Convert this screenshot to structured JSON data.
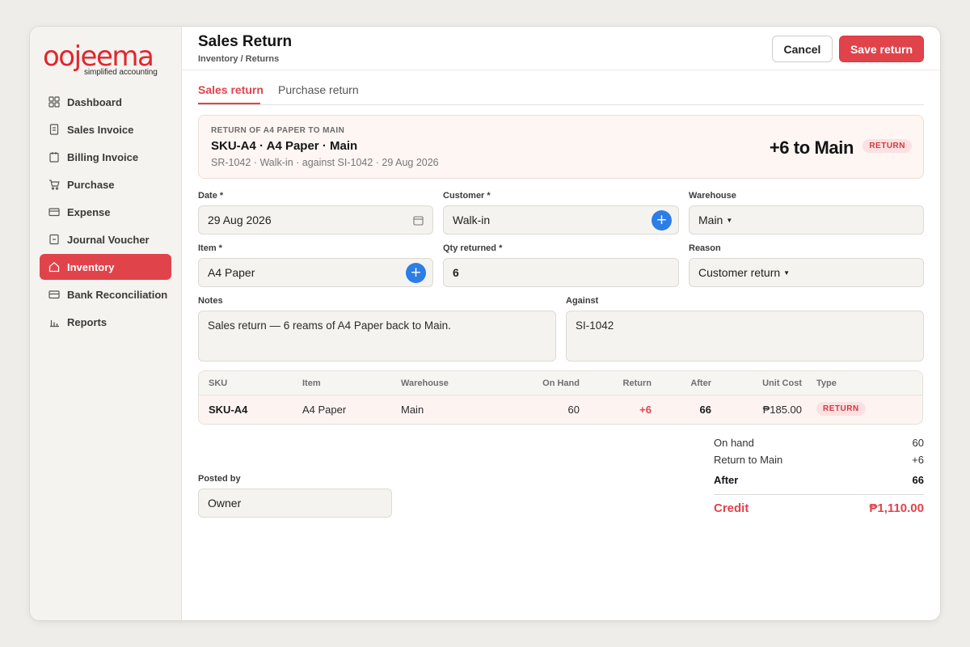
{
  "brand": {
    "name": "oojeema",
    "tagline": "simplified accounting",
    "color": "#e1262d"
  },
  "sidebar": {
    "items": [
      {
        "label": "Dashboard",
        "icon": "grid-icon",
        "active": false
      },
      {
        "label": "Sales Invoice",
        "icon": "document-icon",
        "active": false
      },
      {
        "label": "Billing Invoice",
        "icon": "clipboard-icon",
        "active": false
      },
      {
        "label": "Purchase",
        "icon": "cart-icon",
        "active": false
      },
      {
        "label": "Expense",
        "icon": "card-icon",
        "active": false
      },
      {
        "label": "Journal Voucher",
        "icon": "journal-icon",
        "active": false
      },
      {
        "label": "Inventory",
        "icon": "home-icon",
        "active": true
      },
      {
        "label": "Bank Reconciliation",
        "icon": "bank-card-icon",
        "active": false
      },
      {
        "label": "Reports",
        "icon": "bar-chart-icon",
        "active": false
      }
    ]
  },
  "header": {
    "title": "Sales Return",
    "breadcrumb": "Inventory / Returns",
    "cancel_label": "Cancel",
    "save_label": "Save return"
  },
  "tabs": [
    {
      "label": "Sales return",
      "active": true
    },
    {
      "label": "Purchase return",
      "active": false
    }
  ],
  "summary": {
    "eyebrow": "RETURN OF A4 PAPER TO MAIN",
    "title": "SKU-A4 · A4 Paper · Main",
    "subtitle": "SR-1042 · Walk-in · against SI-1042 · 29 Aug 2026",
    "big_value": "+6 to Main",
    "badge": "RETURN"
  },
  "form": {
    "date": {
      "label": "Date *",
      "value": "29 Aug 2026"
    },
    "customer": {
      "label": "Customer *",
      "value": "Walk-in"
    },
    "warehouse": {
      "label": "Warehouse",
      "value": "Main"
    },
    "item": {
      "label": "Item *",
      "value": "A4 Paper"
    },
    "qty": {
      "label": "Qty returned *",
      "value": "6"
    },
    "reason": {
      "label": "Reason",
      "value": "Customer return"
    },
    "notes": {
      "label": "Notes",
      "value": "Sales return — 6 reams of A4 Paper back to Main."
    },
    "against": {
      "label": "Against",
      "value": "SI-1042"
    },
    "posted_by": {
      "label": "Posted by",
      "value": "Owner"
    }
  },
  "table": {
    "headers": [
      "SKU",
      "Item",
      "Warehouse",
      "On Hand",
      "Return",
      "After",
      "Unit Cost",
      "Type"
    ],
    "rows": [
      {
        "sku": "SKU-A4",
        "item": "A4 Paper",
        "warehouse": "Main",
        "on_hand": "60",
        "return": "+6",
        "after": "66",
        "unit_cost": "₱185.00",
        "type": "RETURN"
      }
    ]
  },
  "totals": {
    "on_hand_label": "On hand",
    "on_hand_value": "60",
    "return_label": "Return to Main",
    "return_value": "+6",
    "after_label": "After",
    "after_value": "66",
    "credit_label": "Credit",
    "credit_value": "₱1,110.00"
  },
  "colors": {
    "accent": "#e1434b",
    "plus_button": "#2d7de6"
  }
}
